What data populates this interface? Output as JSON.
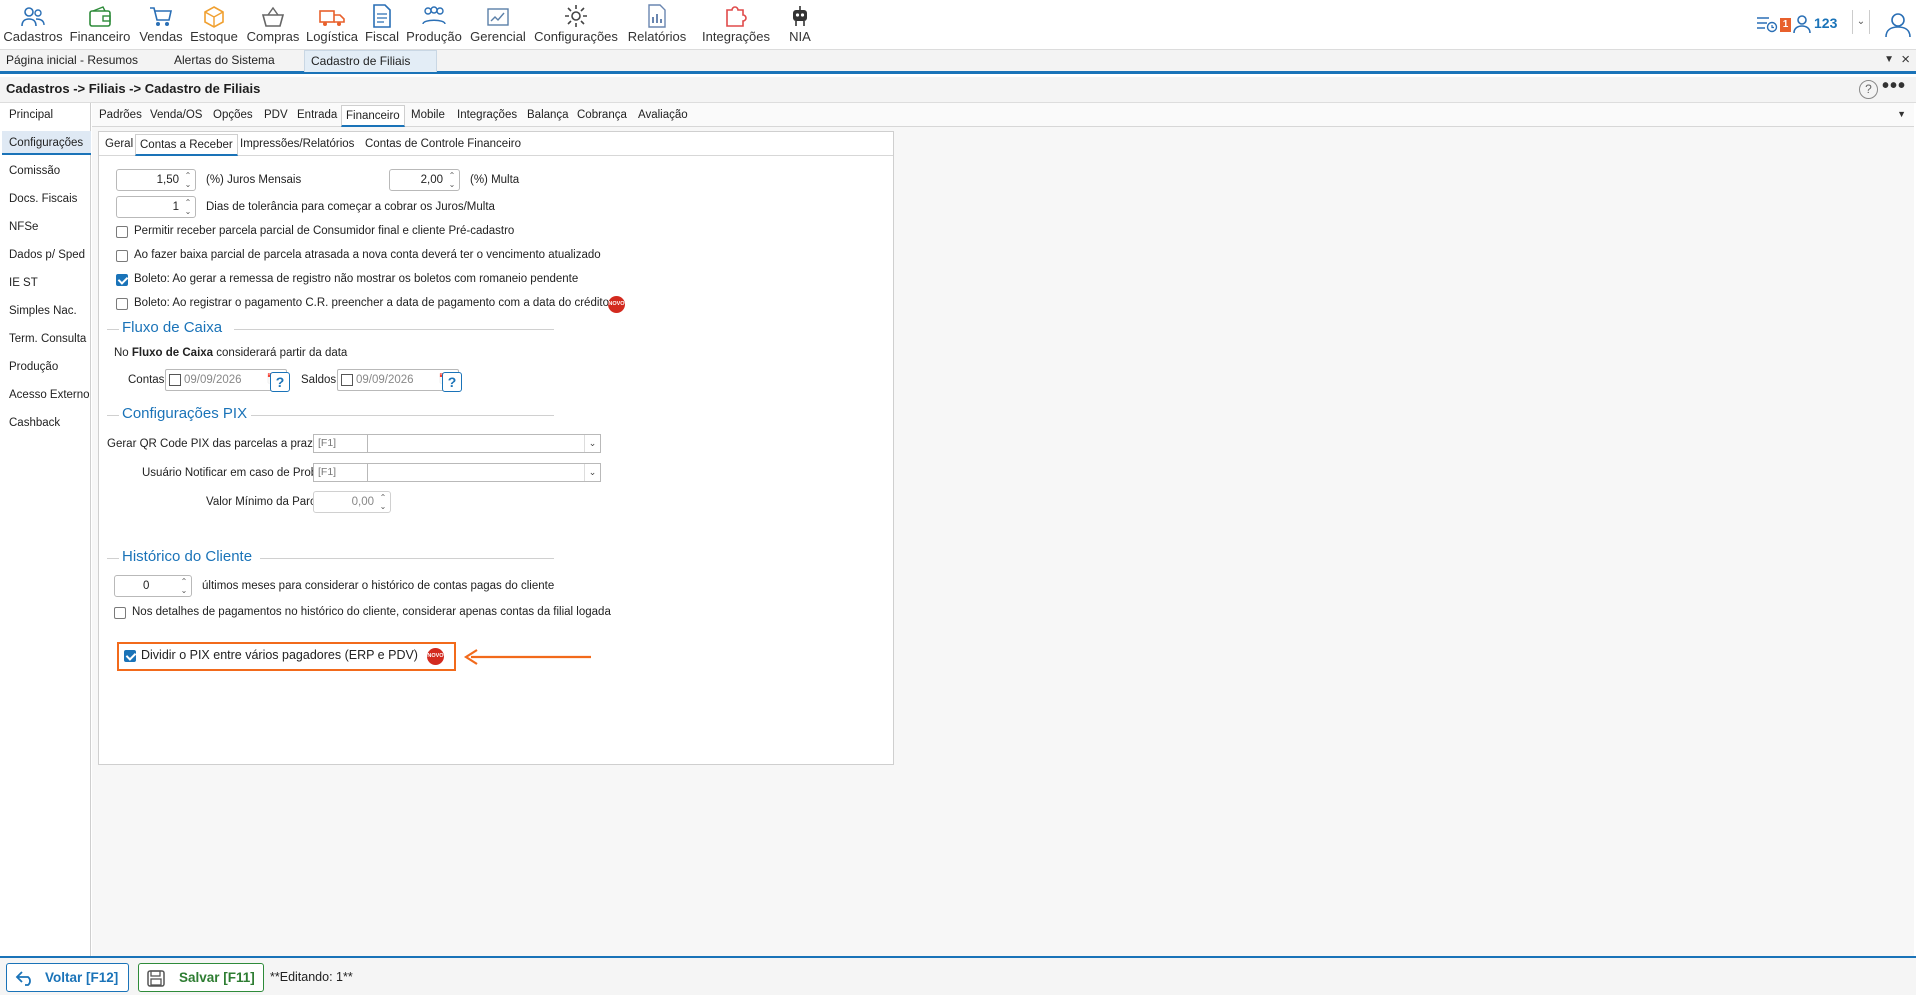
{
  "toolbar": {
    "items": [
      {
        "label": "Cadastros",
        "icon": "users-icon"
      },
      {
        "label": "Financeiro",
        "icon": "wallet-icon"
      },
      {
        "label": "Vendas",
        "icon": "cart-icon"
      },
      {
        "label": "Estoque",
        "icon": "box-icon"
      },
      {
        "label": "Compras",
        "icon": "basket-icon"
      },
      {
        "label": "Logística",
        "icon": "truck-icon"
      },
      {
        "label": "Fiscal",
        "icon": "document-icon"
      },
      {
        "label": "Produção",
        "icon": "team-icon"
      },
      {
        "label": "Gerencial",
        "icon": "dashboard-icon"
      },
      {
        "label": "Configurações",
        "icon": "gear-icon"
      },
      {
        "label": "Relatórios",
        "icon": "report-icon"
      },
      {
        "label": "Integrações",
        "icon": "puzzle-icon"
      },
      {
        "label": "NIA",
        "icon": "robot-icon"
      }
    ],
    "notification_count": "1",
    "user_id": "123"
  },
  "apptabs": [
    "Página inicial - Resumos",
    "Alertas do Sistema",
    "Cadastro de Filiais"
  ],
  "breadcrumb": "Cadastros -> Filiais -> Cadastro de Filiais",
  "leftnav": [
    "Principal",
    "Configurações",
    "Comissão",
    "Docs. Fiscais",
    "NFSe",
    "Dados p/ Sped",
    "IE ST",
    "Simples Nac.",
    "Term. Consulta",
    "Produção",
    "Acesso Externo",
    "Cashback"
  ],
  "tabs1": [
    "Padrões",
    "Venda/OS",
    "Opções",
    "PDV",
    "Entrada",
    "Financeiro",
    "Mobile",
    "Integrações",
    "Balança",
    "Cobrança",
    "Avaliação"
  ],
  "tabs2": [
    "Geral",
    "Contas a Receber",
    "Impressões/Relatórios",
    "Contas de Controle Financeiro"
  ],
  "form": {
    "juros_value": "1,50",
    "juros_label": "(%) Juros Mensais",
    "multa_value": "2,00",
    "multa_label": "(%) Multa",
    "dias_value": "1",
    "dias_label": "Dias de tolerância para começar a cobrar os Juros/Multa",
    "chk1": "Permitir receber parcela parcial de Consumidor final e cliente Pré-cadastro",
    "chk2": "Ao fazer baixa parcial de parcela atrasada a nova conta deverá ter o vencimento atualizado",
    "chk3": "Boleto: Ao gerar a remessa de registro não mostrar os boletos com romaneio pendente",
    "chk4": "Boleto: Ao registrar o pagamento C.R. preencher a data de pagamento com a data do crédito",
    "new_badge": "NOVO"
  },
  "fluxo": {
    "title": "Fluxo de Caixa",
    "desc_prefix": "No",
    "desc_bold": "Fluxo de Caixa",
    "desc_suffix": "considerará partir da data",
    "contas_label": "Contas",
    "contas_date": "09/09/2026",
    "saldos_label": "Saldos",
    "saldos_date": "09/09/2026",
    "help": "?"
  },
  "pix": {
    "title": "Configurações PIX",
    "qr_label": "Gerar QR Code PIX das parcelas a prazo na conta",
    "qr_code": "[F1]",
    "usuario_label": "Usuário Notificar em caso de Problemas",
    "usuario_code": "[F1]",
    "valor_label": "Valor Mínimo da Parcela",
    "valor_value": "0,00",
    "dividir_label": "Dividir o PIX entre vários pagadores (ERP e PDV)"
  },
  "historico": {
    "title": "Histórico do Cliente",
    "meses_value": "0",
    "meses_label": "últimos meses para considerar o histórico de contas pagas do cliente",
    "chk_label": "Nos detalhes de pagamentos no histórico do cliente, considerar apenas contas da filial logada"
  },
  "footer": {
    "voltar": "Voltar [F12]",
    "salvar": "Salvar [F11]",
    "status": "**Editando: 1**"
  },
  "colors": {
    "accent": "#1a73b8",
    "highlight": "#f26a1b",
    "badge": "#d32a1f"
  }
}
